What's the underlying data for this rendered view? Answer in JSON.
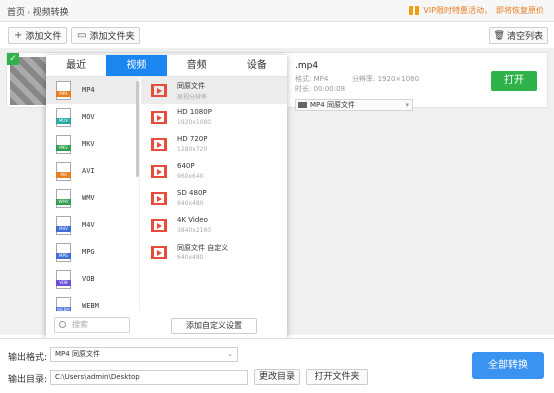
{
  "breadcrumb": {
    "home": "首页",
    "current": "视频转换"
  },
  "promo": {
    "text": "VIP限时特惠活动，",
    "link": "即将恢复原价"
  },
  "toolbar": {
    "add_file": "添加文件",
    "add_folder": "添加文件夹",
    "clear_list": "清空列表"
  },
  "file": {
    "name": ".mp4",
    "format_label": "格式: MP4",
    "resolution_label": "分辨率: 1920×1080",
    "duration_label": "时长: 00:00:08",
    "output_format": "MP4  同原文件",
    "open_button": "打开"
  },
  "popup": {
    "tabs": [
      "最近",
      "视频",
      "音频",
      "设备"
    ],
    "active_tab": 1,
    "formats": [
      {
        "name": "MP4",
        "color": "#e67e22"
      },
      {
        "name": "MOV",
        "color": "#27a8a0"
      },
      {
        "name": "MKV",
        "color": "#2e9e4f"
      },
      {
        "name": "AVI",
        "color": "#e67e22"
      },
      {
        "name": "WMV",
        "color": "#2e9e4f"
      },
      {
        "name": "M4V",
        "color": "#3f6fd8"
      },
      {
        "name": "MPG",
        "color": "#3f6fd8"
      },
      {
        "name": "VOB",
        "color": "#6c4fd8"
      },
      {
        "name": "WEBM",
        "color": "#3f6fd8"
      }
    ],
    "presets": [
      {
        "title": "同原文件",
        "sub": "原视分辨率"
      },
      {
        "title": "HD 1080P",
        "sub": "1920x1080"
      },
      {
        "title": "HD 720P",
        "sub": "1280x720"
      },
      {
        "title": "640P",
        "sub": "960x640"
      },
      {
        "title": "SD 480P",
        "sub": "640x480"
      },
      {
        "title": "4K Video",
        "sub": "3840x2160"
      },
      {
        "title": "同原文件 自定义",
        "sub": "640x480"
      }
    ],
    "search_placeholder": "搜索",
    "add_custom": "添加自定义设置"
  },
  "bottom": {
    "output_format_label": "输出格式:",
    "output_format_value": "MP4  同原文件",
    "output_dir_label": "输出目录:",
    "output_dir_value": "C:\\Users\\admin\\Desktop",
    "change_dir": "更改目录",
    "open_folder": "打开文件夹",
    "convert_all": "全部转换"
  }
}
